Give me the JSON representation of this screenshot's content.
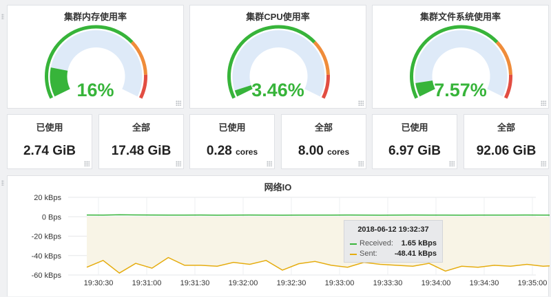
{
  "gauges": [
    {
      "title": "集群内存使用率",
      "value_text": "16%",
      "value": 16
    },
    {
      "title": "集群CPU使用率",
      "value_text": "3.46%",
      "value": 3.46
    },
    {
      "title": "集群文件系统使用率",
      "value_text": "7.57%",
      "value": 7.57
    }
  ],
  "stats": [
    {
      "label": "已使用",
      "value": "2.74 GiB",
      "unit": ""
    },
    {
      "label": "全部",
      "value": "17.48 GiB",
      "unit": ""
    },
    {
      "label": "已使用",
      "value": "0.28",
      "unit": "cores"
    },
    {
      "label": "全部",
      "value": "8.00",
      "unit": "cores"
    },
    {
      "label": "已使用",
      "value": "6.97 GiB",
      "unit": ""
    },
    {
      "label": "全部",
      "value": "92.06 GiB",
      "unit": ""
    }
  ],
  "network": {
    "title": "网络IO",
    "tooltip": {
      "time": "2018-06-12 19:32:37",
      "rows": [
        {
          "name": "Received:",
          "value": "1.65 kBps"
        },
        {
          "name": "Sent:",
          "value": "-48.41 kBps"
        }
      ]
    }
  },
  "colors": {
    "green": "#37b43a",
    "orange": "#ef8c3a",
    "red": "#e24d42",
    "yellow": "#e5ac0e",
    "gauge_bg": "#deeaf8"
  },
  "chart_data": {
    "type": "line",
    "y_ticks": [
      "20 kBps",
      "0 Bps",
      "-20 kBps",
      "-40 kBps",
      "-60 kBps"
    ],
    "y_tick_values": [
      20,
      0,
      -20,
      -40,
      -60
    ],
    "x_ticks": [
      "19:30:30",
      "19:31:00",
      "19:31:30",
      "19:32:00",
      "19:32:30",
      "19:33:00",
      "19:33:30",
      "19:34:00",
      "19:34:30",
      "19:35:00"
    ],
    "ylim": [
      -60,
      20
    ],
    "series": [
      {
        "name": "Received",
        "color": "#37b43a",
        "values": [
          1.8,
          1.7,
          2.0,
          1.9,
          1.8,
          1.7,
          1.7,
          1.8,
          1.6,
          1.7,
          1.8,
          1.7,
          1.6,
          1.65,
          1.7,
          1.7,
          1.8,
          1.7,
          1.6,
          1.7,
          1.8,
          1.7,
          1.7,
          1.6,
          1.7,
          1.7,
          1.7,
          1.8,
          1.7,
          1.7,
          1.7
        ]
      },
      {
        "name": "Sent",
        "color": "#e5ac0e",
        "values": [
          -52,
          -45,
          -58,
          -48,
          -53,
          -42,
          -50,
          -50,
          -51,
          -47,
          -49,
          -45,
          -55,
          -48.41,
          -46,
          -50,
          -52,
          -47,
          -49,
          -50,
          -51,
          -48,
          -56,
          -51,
          -52,
          -50,
          -51,
          -49,
          -51,
          -50,
          -50
        ]
      }
    ]
  }
}
